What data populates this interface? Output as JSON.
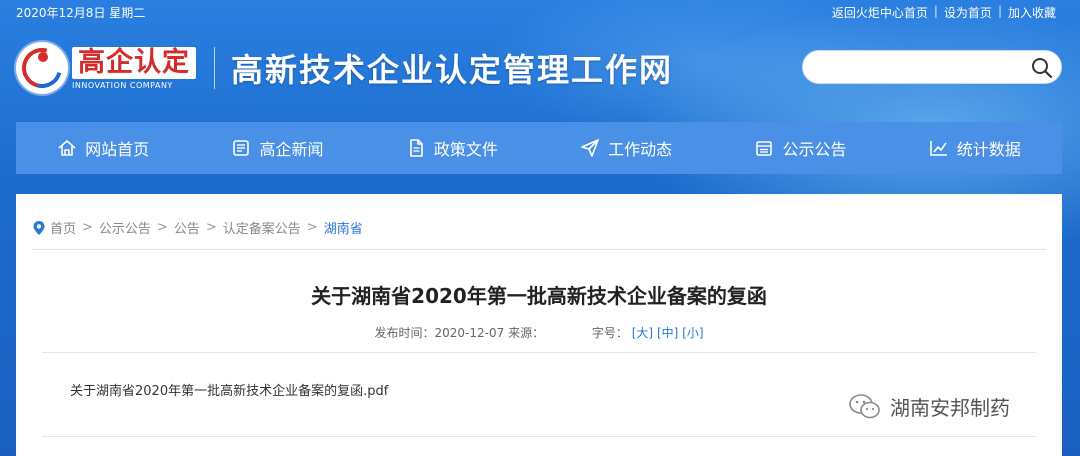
{
  "topbar": {
    "date": "2020年12月8日 星期二",
    "links": [
      "返回火炬中心首页",
      "设为首页",
      "加入收藏"
    ],
    "separator": "|"
  },
  "logo": {
    "cn": "高企认定",
    "en": "INNOVATION COMPANY"
  },
  "site_title": "高新技术企业认定管理工作网",
  "search": {
    "value": "",
    "placeholder": ""
  },
  "nav": [
    {
      "label": "网站首页",
      "icon": "home-icon"
    },
    {
      "label": "高企新闻",
      "icon": "news-icon"
    },
    {
      "label": "政策文件",
      "icon": "document-icon"
    },
    {
      "label": "工作动态",
      "icon": "send-icon"
    },
    {
      "label": "公示公告",
      "icon": "bulletin-icon"
    },
    {
      "label": "统计数据",
      "icon": "chart-icon"
    }
  ],
  "breadcrumb": {
    "items": [
      "首页",
      "公示公告",
      "公告",
      "认定备案公告"
    ],
    "current": "湖南省",
    "arrow": ">"
  },
  "article": {
    "title": "关于湖南省2020年第一批高新技术企业备案的复函",
    "publish_label": "发布时间：",
    "publish_date": "2020-12-07",
    "source_label": "来源：",
    "size_label": "字号：",
    "size_large": "[大]",
    "size_medium": "[中]",
    "size_small": "[小]",
    "attachment": "关于湖南省2020年第一批高新技术企业备案的复函.pdf"
  },
  "watermark": "湖南安邦制药",
  "colors": {
    "header_blue": "#1c6ccd",
    "nav_blue": "#4a90e6",
    "logo_red": "#d52b2b",
    "link_blue": "#2a78d6"
  }
}
